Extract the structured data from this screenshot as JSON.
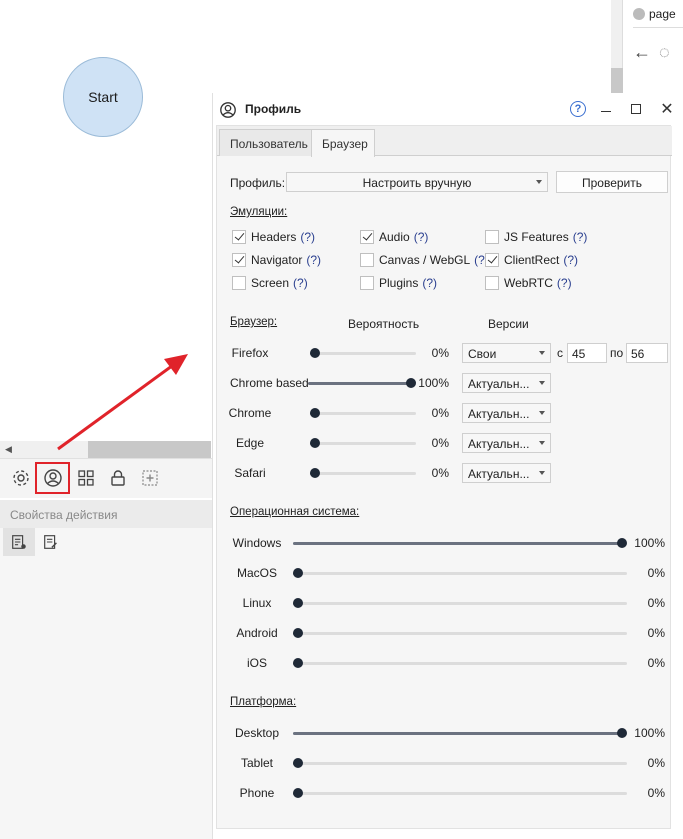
{
  "canvas": {
    "start_node": "Start"
  },
  "background_window": {
    "tab_title": "page"
  },
  "props": {
    "header": "Свойства действия"
  },
  "dialog": {
    "title": "Профиль",
    "help": "?",
    "tabs": [
      {
        "label": "Пользователь"
      },
      {
        "label": "Браузер"
      }
    ],
    "profile": {
      "label": "Профиль:",
      "value": "Настроить вручную",
      "check_button": "Проверить"
    },
    "emulation": {
      "title": "Эмуляции:",
      "items": [
        {
          "label": "Headers",
          "help": "(?)",
          "checked": true
        },
        {
          "label": "Audio",
          "help": "(?)",
          "checked": true
        },
        {
          "label": "JS Features",
          "help": "(?)",
          "checked": false
        },
        {
          "label": "Navigator",
          "help": "(?)",
          "checked": true
        },
        {
          "label": "Canvas / WebGL",
          "help": "(?)",
          "checked": false
        },
        {
          "label": "ClientRect",
          "help": "(?)",
          "checked": true
        },
        {
          "label": "Screen",
          "help": "(?)",
          "checked": false
        },
        {
          "label": "Plugins",
          "help": "(?)",
          "checked": false
        },
        {
          "label": "WebRTC",
          "help": "(?)",
          "checked": false
        }
      ]
    },
    "browser": {
      "title": "Браузер:",
      "probability_header": "Вероятность",
      "versions_header": "Версии",
      "from_label": "с",
      "to_label": "по",
      "rows": [
        {
          "name": "Firefox",
          "value": 0,
          "pct": "0%",
          "version": "Свои",
          "from": "45",
          "to": "56"
        },
        {
          "name": "Chrome based",
          "value": 100,
          "pct": "100%",
          "version": "Актуальн..."
        },
        {
          "name": "Chrome",
          "value": 0,
          "pct": "0%",
          "version": "Актуальн..."
        },
        {
          "name": "Edge",
          "value": 0,
          "pct": "0%",
          "version": "Актуальн..."
        },
        {
          "name": "Safari",
          "value": 0,
          "pct": "0%",
          "version": "Актуальн..."
        }
      ]
    },
    "os": {
      "title": "Операционная система:",
      "rows": [
        {
          "name": "Windows",
          "value": 100,
          "pct": "100%"
        },
        {
          "name": "MacOS",
          "value": 0,
          "pct": "0%"
        },
        {
          "name": "Linux",
          "value": 0,
          "pct": "0%"
        },
        {
          "name": "Android",
          "value": 0,
          "pct": "0%"
        },
        {
          "name": "iOS",
          "value": 0,
          "pct": "0%"
        }
      ]
    },
    "platform": {
      "title": "Платформа:",
      "rows": [
        {
          "name": "Desktop",
          "value": 100,
          "pct": "100%"
        },
        {
          "name": "Tablet",
          "value": 0,
          "pct": "0%"
        },
        {
          "name": "Phone",
          "value": 0,
          "pct": "0%"
        }
      ]
    }
  },
  "colors": {
    "highlight": "#e0232a",
    "start_node_fill": "#cfe2f5",
    "slider_knob": "#1f2937",
    "help_link": "#2a3f8f"
  }
}
